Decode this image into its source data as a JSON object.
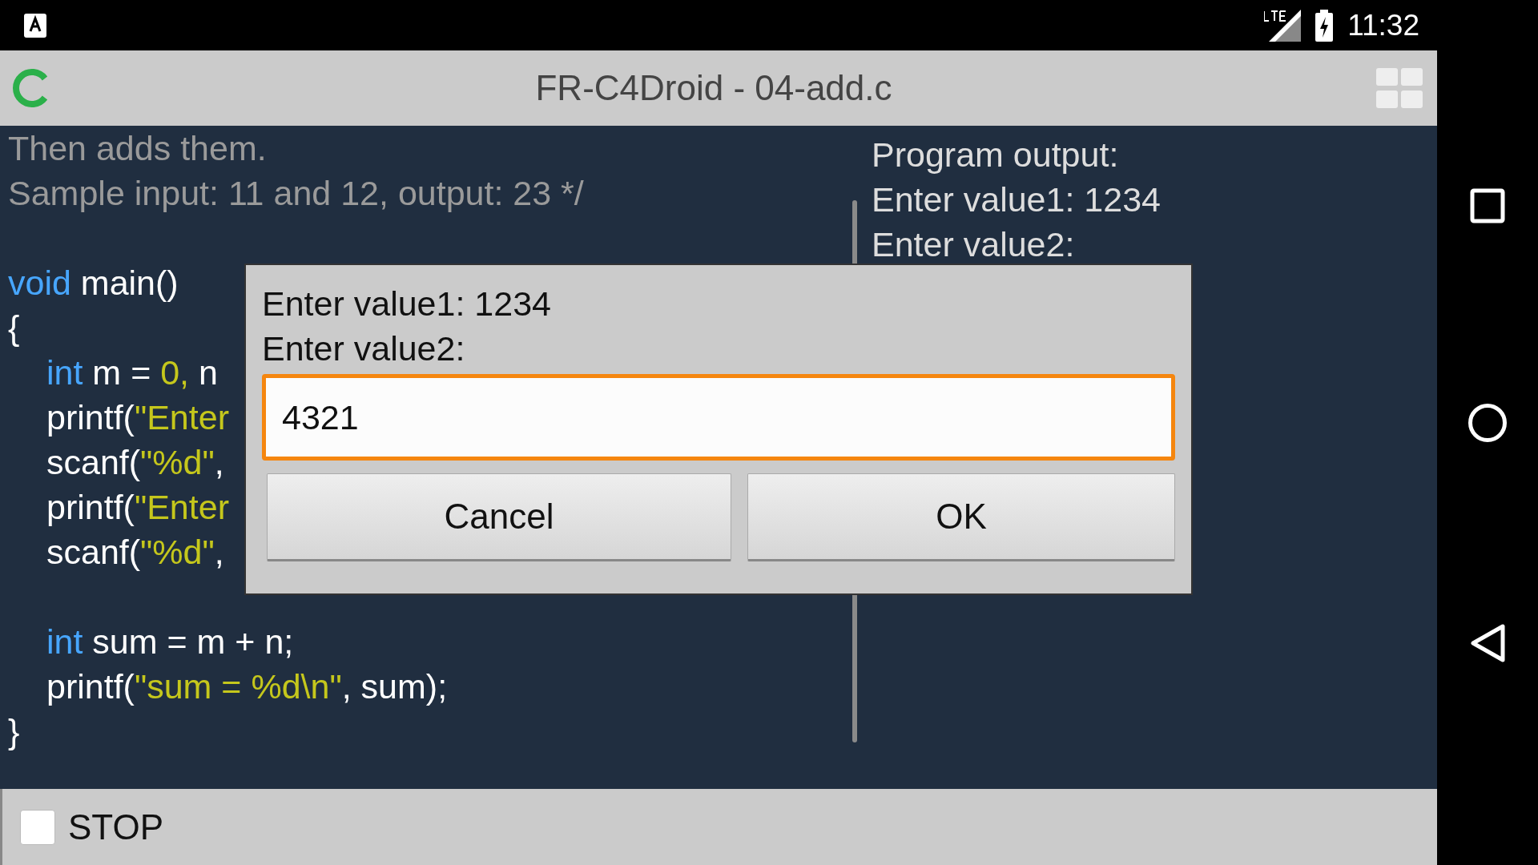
{
  "status_bar": {
    "time": "11:32"
  },
  "app_bar": {
    "title": "FR-C4Droid - 04-add.c"
  },
  "code": {
    "lines": [
      {
        "kind": "code",
        "indented": false,
        "tokens": [
          {
            "kind": "comment",
            "text": "Then adds them."
          }
        ]
      },
      {
        "kind": "code",
        "indented": false,
        "tokens": [
          {
            "kind": "comment",
            "text": "Sample input: 11 and 12, output: 23 */"
          }
        ]
      },
      {
        "kind": "blank"
      },
      {
        "kind": "code",
        "indented": false,
        "tokens": [
          {
            "kind": "keyword",
            "text": "void"
          },
          {
            "kind": "plain",
            "text": " main()"
          }
        ]
      },
      {
        "kind": "code",
        "indented": false,
        "tokens": [
          {
            "kind": "plain",
            "text": "{"
          }
        ]
      },
      {
        "kind": "code",
        "indented": true,
        "tokens": [
          {
            "kind": "keyword",
            "text": "int"
          },
          {
            "kind": "plain",
            "text": " m = "
          },
          {
            "kind": "number",
            "text": "0,"
          },
          {
            "kind": "plain",
            "text": " n"
          }
        ]
      },
      {
        "kind": "code",
        "indented": true,
        "tokens": [
          {
            "kind": "plain",
            "text": "printf("
          },
          {
            "kind": "string",
            "text": "\"Enter"
          }
        ]
      },
      {
        "kind": "code",
        "indented": true,
        "tokens": [
          {
            "kind": "plain",
            "text": "scanf("
          },
          {
            "kind": "string",
            "text": "\"%d\""
          },
          {
            "kind": "plain",
            "text": ","
          }
        ]
      },
      {
        "kind": "code",
        "indented": true,
        "tokens": [
          {
            "kind": "plain",
            "text": "printf("
          },
          {
            "kind": "string",
            "text": "\"Enter"
          }
        ]
      },
      {
        "kind": "code",
        "indented": true,
        "tokens": [
          {
            "kind": "plain",
            "text": "scanf("
          },
          {
            "kind": "string",
            "text": "\"%d\""
          },
          {
            "kind": "plain",
            "text": ","
          }
        ]
      },
      {
        "kind": "blank"
      },
      {
        "kind": "code",
        "indented": true,
        "tokens": [
          {
            "kind": "keyword",
            "text": "int"
          },
          {
            "kind": "plain",
            "text": " sum = m + n;"
          }
        ]
      },
      {
        "kind": "code",
        "indented": true,
        "tokens": [
          {
            "kind": "plain",
            "text": "printf("
          },
          {
            "kind": "string",
            "text": "\"sum = %d\\n\""
          },
          {
            "kind": "plain",
            "text": ", sum);"
          }
        ]
      },
      {
        "kind": "code",
        "indented": false,
        "tokens": [
          {
            "kind": "plain",
            "text": "}"
          }
        ]
      }
    ]
  },
  "output": {
    "lines": [
      "Program output:",
      "Enter value1: 1234",
      "Enter value2:"
    ]
  },
  "dialog": {
    "message_lines": [
      "Enter value1: 1234",
      "Enter value2:"
    ],
    "input": {
      "value": "4321",
      "focused": true
    },
    "buttons": [
      "Cancel",
      "OK"
    ]
  },
  "bottom_bar": {
    "stop_checkbox": {
      "label": "STOP",
      "checked": false
    }
  }
}
